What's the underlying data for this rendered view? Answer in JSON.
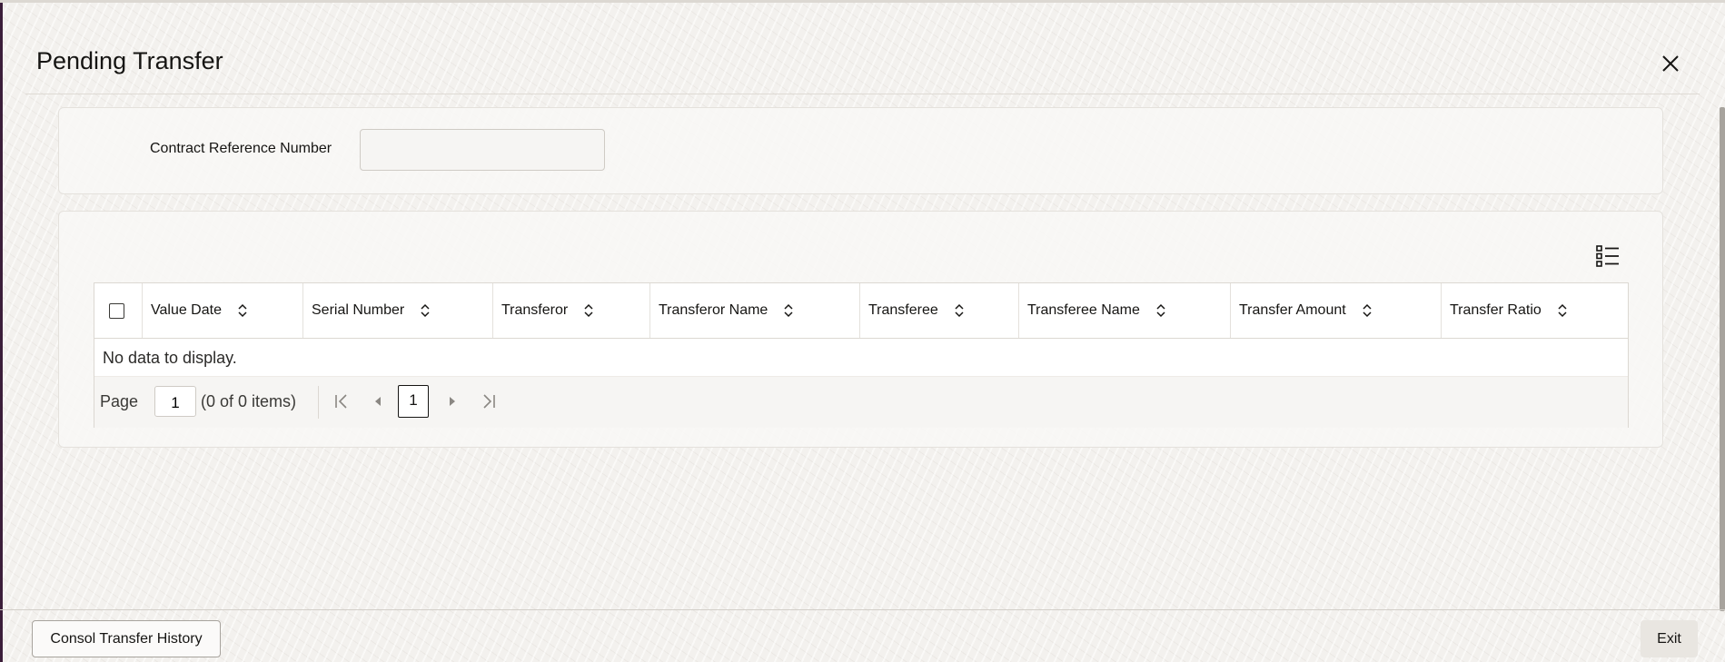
{
  "window": {
    "title": "Pending Transfer"
  },
  "search": {
    "contract_ref_label": "Contract Reference Number",
    "contract_ref_value": ""
  },
  "table": {
    "columns": [
      "Value Date",
      "Serial Number",
      "Transferor",
      "Transferor Name",
      "Transferee",
      "Transferee Name",
      "Transfer Amount",
      "Transfer Ratio"
    ],
    "empty_message": "No data to display."
  },
  "pagination": {
    "page_label": "Page",
    "page_value": "1",
    "items_summary": "(0 of 0 items)",
    "current_page": "1"
  },
  "footer": {
    "history_button": "Consol Transfer History",
    "exit_button": "Exit"
  },
  "icons": {
    "close": "close-icon",
    "sort": "sort-icon",
    "view": "list-view-icon",
    "first": "first-page-icon",
    "prev": "previous-page-icon",
    "next": "next-page-icon",
    "last": "last-page-icon"
  }
}
